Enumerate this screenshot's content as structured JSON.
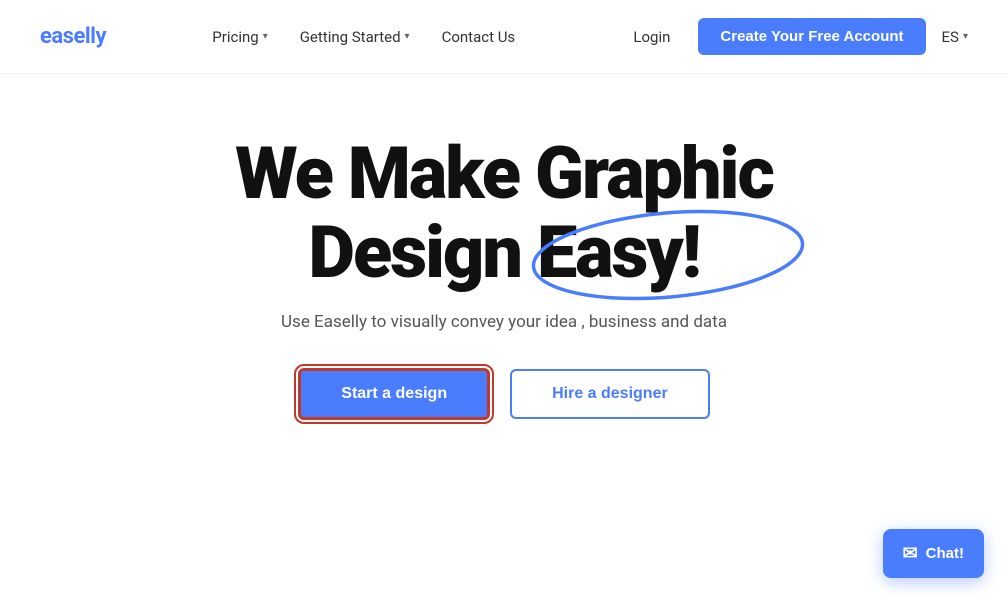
{
  "logo": {
    "text_black": "easell",
    "text_blue": "y"
  },
  "nav": {
    "items": [
      {
        "label": "Pricing",
        "has_dropdown": true
      },
      {
        "label": "Getting Started",
        "has_dropdown": true
      },
      {
        "label": "Contact Us",
        "has_dropdown": false
      }
    ]
  },
  "header_right": {
    "login_label": "Login",
    "create_account_label": "Create Your Free Account",
    "lang_label": "ES"
  },
  "hero": {
    "title_line1": "We Make Graphic",
    "title_line2_prefix": "Design ",
    "title_line2_highlight": "Easy!",
    "subtitle": "Use Easelly to visually convey your idea , business and data",
    "btn_start": "Start a design",
    "btn_hire": "Hire a designer"
  },
  "chat": {
    "label": "Chat!"
  }
}
